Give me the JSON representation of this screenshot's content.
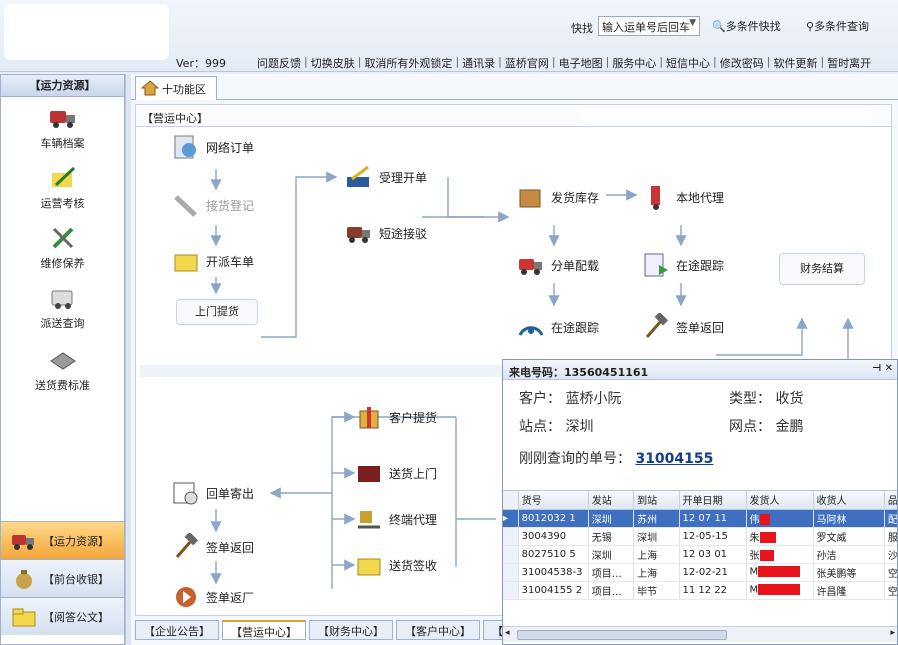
{
  "header": {
    "version": "Ver：999",
    "quick_label": "快找",
    "quick_select_value": "输入运单号后回车",
    "multi_quick": "多条件快找",
    "multi_search": "多条件查询",
    "menu": [
      "问题反馈",
      "切换皮肤",
      "取消所有外观锁定",
      "通讯录",
      "蓝桥官网",
      "电子地图",
      "服务中心",
      "短信中心",
      "修改密码",
      "软件更新",
      "暂时离开"
    ]
  },
  "sidebar": {
    "title": "【运力资源】",
    "items": [
      {
        "label": "车辆档案",
        "icon": "truck-icon"
      },
      {
        "label": "运营考核",
        "icon": "pencil-paper-icon"
      },
      {
        "label": "维修保养",
        "icon": "wrench-icon"
      },
      {
        "label": "派送查询",
        "icon": "van-search-icon"
      },
      {
        "label": "送货费标准",
        "icon": "device-icon"
      }
    ],
    "tabs": [
      {
        "label": "【运力资源】",
        "icon": "truck-icon"
      },
      {
        "label": "【前台收银】",
        "icon": "money-bag-icon"
      },
      {
        "label": "【阅答公文】",
        "icon": "folder-icon"
      }
    ]
  },
  "main": {
    "tab_label": "十功能区",
    "section_label": "【营运中心】",
    "flow": {
      "web_order": "网络订单",
      "pickup_register": "接货登记",
      "dispatch_order": "开派车单",
      "door_pickup": "上门提货",
      "accept_order": "受理开单",
      "short_transfer": "短途接驳",
      "ship_inventory": "发货库存",
      "local_agent": "本地代理",
      "split_load": "分单配载",
      "in_transit_track_1": "在途跟踪",
      "in_transit_track_2": "在途跟踪",
      "sign_return_1": "签单返回",
      "finance_settle": "财务结算",
      "customer_pickup": "客户提货",
      "home_delivery": "送货上门",
      "terminal_agent": "终端代理",
      "delivery_sign": "送货签收",
      "receipt_mail": "回单寄出",
      "sign_return_2": "签单返回",
      "sign_return_factory": "签单返厂"
    },
    "bottom_tabs": [
      "【企业公告】",
      "【营运中心】",
      "【财务中心】",
      "【客户中心】",
      "【人事行"
    ]
  },
  "popup": {
    "caller_label": "来电号码：",
    "caller_number": "13560451161",
    "customer": "客户：  蓝桥小阮",
    "type": "类型：  收货",
    "station": "站点：  深圳",
    "outlet": "网点：  金鹏",
    "recent_label": "刚刚查询的单号：",
    "recent_number": "31004155",
    "columns": [
      "货号",
      "发站",
      "到站",
      "开单日期",
      "发货人",
      "收货人",
      "品名"
    ],
    "rows": [
      [
        "8012032 1",
        "深圳",
        "苏州",
        "12 07 11",
        "伟",
        "马阿林",
        "配件"
      ],
      [
        "3004390",
        "无锡",
        "深圳",
        "12-05-15",
        "朱",
        "罗文威",
        "服装"
      ],
      [
        "8027510 5",
        "深圳",
        "上海",
        "12 03 01",
        "张",
        "孙洁",
        "沙发"
      ],
      [
        "31004538-3",
        "项目…",
        "上海",
        "12-02-21",
        "M",
        "张美鹏等",
        "空调"
      ],
      [
        "31004155 2",
        "项目…",
        "毕节",
        "11 12 22",
        "M",
        "许昌隆",
        "空调"
      ]
    ],
    "selected_row": 0
  },
  "colors": {
    "accent": "#f3a63a",
    "selection": "#3f6fc0",
    "link": "#143c8c",
    "redaction": "#e8141b"
  }
}
